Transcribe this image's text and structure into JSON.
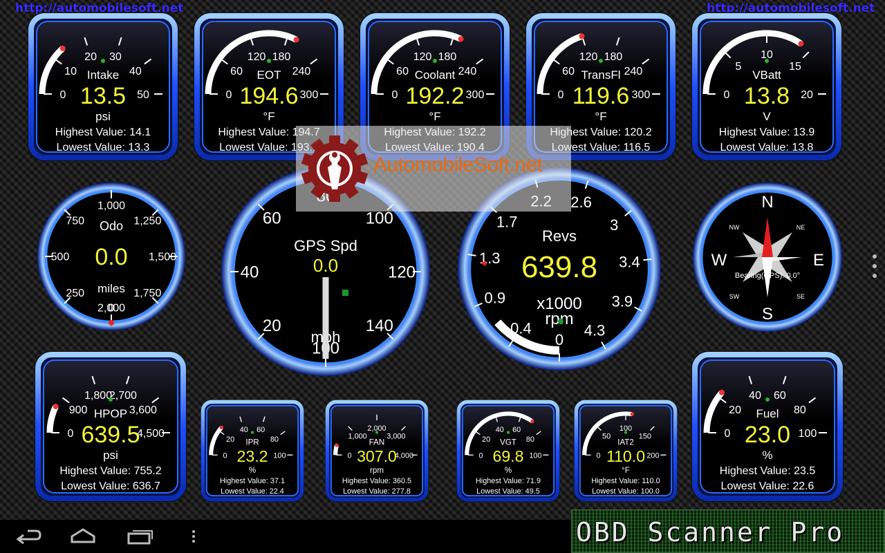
{
  "header": {
    "url_left": "http://automobilesoft.net",
    "url_right": "http://automobilesoft.net"
  },
  "watermark": {
    "text": "AutomobileSoft.net"
  },
  "brand": {
    "text": "OBD Scanner Pro"
  },
  "colors": {
    "accent": "#1f6bff",
    "value": "#f5f536",
    "needle": "#ffffff",
    "watermark_text": "#e26a1a"
  },
  "gauges": {
    "intake": {
      "label": "Intake",
      "value": "13.5",
      "unit": "psi",
      "ticks": [
        "0",
        "10",
        "20",
        "30",
        "40",
        "50"
      ],
      "highest": "Highest Value: 14.1",
      "lowest": "Lowest Value: 13.3",
      "reading": 13.5,
      "min": 0,
      "max": 50
    },
    "eot": {
      "label": "EOT",
      "value": "194.6",
      "unit": "°F",
      "ticks": [
        "0",
        "60",
        "120",
        "180",
        "240",
        "300"
      ],
      "highest": "Highest Value: 194.7",
      "lowest": "Lowest Value: 193.1",
      "reading": 194.6,
      "min": 0,
      "max": 300
    },
    "coolant": {
      "label": "Coolant",
      "value": "192.2",
      "unit": "°F",
      "ticks": [
        "0",
        "60",
        "120",
        "180",
        "240",
        "300"
      ],
      "highest": "Highest Value: 192.2",
      "lowest": "Lowest Value: 190.4",
      "reading": 192.2,
      "min": 0,
      "max": 300
    },
    "transfl": {
      "label": "TransFl",
      "value": "119.6",
      "unit": "°F",
      "ticks": [
        "0",
        "60",
        "120",
        "180",
        "240",
        "300"
      ],
      "highest": "Highest Value: 120.2",
      "lowest": "Lowest Value: 116.5",
      "reading": 119.6,
      "min": 0,
      "max": 300
    },
    "vbatt": {
      "label": "VBatt",
      "value": "13.8",
      "unit": "V",
      "ticks": [
        "0",
        "5",
        "10",
        "15",
        "20"
      ],
      "highest": "Highest Value: 13.9",
      "lowest": "Lowest Value: 13.8",
      "reading": 13.8,
      "min": 0,
      "max": 20
    },
    "odo": {
      "label": "Odo",
      "value": "0.0",
      "unit": "miles",
      "ticks": [
        "0",
        "250",
        "500",
        "750",
        "1,000",
        "1,250",
        "1,500",
        "1,750",
        "2,000"
      ],
      "reading": 0,
      "min": 0,
      "max": 2000
    },
    "gps": {
      "label": "GPS Spd",
      "value": "0.0",
      "unit": "mph",
      "ticks": [
        "0",
        "20",
        "40",
        "60",
        "80",
        "100",
        "120",
        "140",
        "160"
      ],
      "reading": 0,
      "min": 0,
      "max": 160
    },
    "revs": {
      "label": "Revs",
      "value": "639.8",
      "unit": "x1000\nrpm",
      "unit_line1": "x1000",
      "unit_line2": "rpm",
      "ticks": [
        "0",
        "0.4",
        "0.9",
        "1.3",
        "1.7",
        "2.2",
        "2.6",
        "3",
        "3.4",
        "3.9",
        "4.3"
      ],
      "reading": 0.64,
      "min": 0,
      "max": 4.3
    },
    "compass": {
      "n": "N",
      "s": "S",
      "e": "E",
      "w": "W",
      "nw": "NW",
      "ne": "NE",
      "sw": "SW",
      "se": "SE",
      "bearing": "Bearing(GPS): 0.0°",
      "heading_deg": 0
    },
    "hpop": {
      "label": "HPOP",
      "value": "639.5",
      "unit": "psi",
      "ticks": [
        "0",
        "900",
        "1,800",
        "2,700",
        "3,600",
        "4,500"
      ],
      "highest": "Highest Value: 755.2",
      "lowest": "Lowest Value: 636.7",
      "reading": 639.5,
      "min": 0,
      "max": 4500
    },
    "ipr": {
      "label": "IPR",
      "value": "23.2",
      "unit": "%",
      "ticks": [
        "0",
        "20",
        "40",
        "60",
        "80",
        "100"
      ],
      "highest": "Highest Value: 37.1",
      "lowest": "Lowest Value: 22.4",
      "reading": 23.2,
      "min": 0,
      "max": 100
    },
    "fan": {
      "label": "FAN",
      "value": "307.0",
      "unit": "rpm",
      "ticks": [
        "0",
        "1,000",
        "2,000",
        "3,000",
        "4,000"
      ],
      "highest": "Highest Value: 360.5",
      "lowest": "Lowest Value: 277.8",
      "reading": 307,
      "min": 0,
      "max": 4000
    },
    "vgt": {
      "label": "VGT",
      "value": "69.8",
      "unit": "%",
      "ticks": [
        "0",
        "20",
        "40",
        "60",
        "80",
        "100"
      ],
      "highest": "Highest Value: 71.9",
      "lowest": "Lowest Value: 49.5",
      "reading": 69.8,
      "min": 0,
      "max": 100
    },
    "iat2": {
      "label": "IAT2",
      "value": "110.0",
      "unit": "°F",
      "ticks": [
        "0",
        "50",
        "100",
        "150",
        "200"
      ],
      "highest": "Highest Value: 110.0",
      "lowest": "Lowest Value: 100.0",
      "reading": 110,
      "min": 0,
      "max": 200
    },
    "fuel": {
      "label": "Fuel",
      "value": "23.0",
      "unit": "%",
      "ticks": [
        "0",
        "20",
        "40",
        "60",
        "80",
        "100"
      ],
      "highest": "Highest Value: 23.5",
      "lowest": "Lowest Value: 22.6",
      "reading": 23,
      "min": 0,
      "max": 100
    }
  },
  "navbar": {
    "back_icon": "back-arrow-icon",
    "home_icon": "home-icon",
    "recents_icon": "recent-apps-icon",
    "menu_icon": "overflow-menu-icon"
  }
}
